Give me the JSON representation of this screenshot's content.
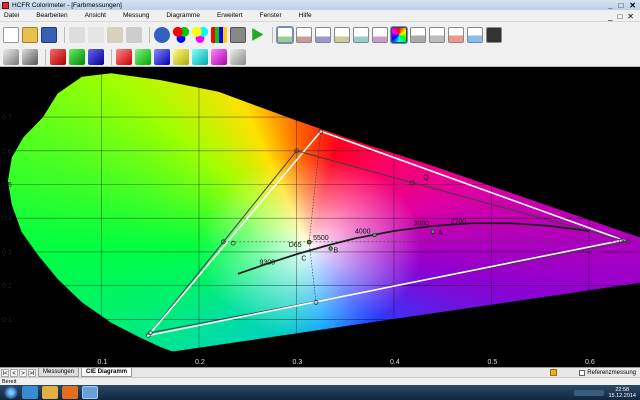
{
  "window": {
    "title": "HCFR Colorimeter - [Farbmessungen]",
    "controls": [
      "_",
      "□",
      "✕"
    ],
    "mdi_controls": [
      "_",
      "□",
      "✕"
    ]
  },
  "menu": [
    "Datei",
    "Bearbeiten",
    "Ansicht",
    "Messung",
    "Diagramme",
    "Erweitert",
    "Fenster",
    "Hilfe"
  ],
  "toolbar": {
    "row1_icons": [
      "new-icon",
      "open-icon",
      "save-icon",
      "cut-icon",
      "copy-icon",
      "paste-icon",
      "print-icon",
      "help-icon",
      "primaries-icon",
      "secondaries-icon",
      "color-patches-icon",
      "camera-icon",
      "play-icon",
      "graph-icon",
      "graph-icon",
      "graph-icon",
      "graph-icon",
      "graph-icon",
      "graph-icon",
      "cie-diagram-icon",
      "graph-icon",
      "graph-icon",
      "graph-icon",
      "graph-icon",
      "graph-icon"
    ],
    "row2_icons": [
      "gray-measure-icon",
      "gray-measure-icon",
      "red-measure-icon",
      "green-measure-icon",
      "blue-measure-icon",
      "red-measure-icon",
      "green-measure-icon",
      "blue-measure-icon",
      "yellow-measure-icon",
      "cyan-measure-icon",
      "magenta-measure-icon",
      "gray-measure-icon"
    ]
  },
  "cie": {
    "xticks": [
      "0.1",
      "0.2",
      "0.3",
      "0.4",
      "0.5",
      "0.6"
    ],
    "yticks": [
      "0.7",
      "0.6",
      "0.5",
      "0.4",
      "0.3",
      "0.2",
      "0.1"
    ],
    "locus_labels": [
      "9300",
      "D65",
      "5500",
      "4000",
      "3000",
      "2700"
    ],
    "point_labels": [
      "C",
      "B",
      "A",
      "Q"
    ],
    "colors": {
      "gamut_measured": "#ffffff",
      "gamut_reference": "#404040",
      "planckian": "#202020"
    }
  },
  "tabs": {
    "nav": [
      "I<",
      "<",
      ">",
      ">I"
    ],
    "items": [
      "Messungen",
      "CIE Diagramm"
    ],
    "active": "CIE Diagramm"
  },
  "reference_checkbox": {
    "label": "Referenzmessung",
    "checked": false
  },
  "status": {
    "text": "Bereit"
  },
  "taskbar": {
    "time": "22:58",
    "date": "15.12.2014"
  }
}
